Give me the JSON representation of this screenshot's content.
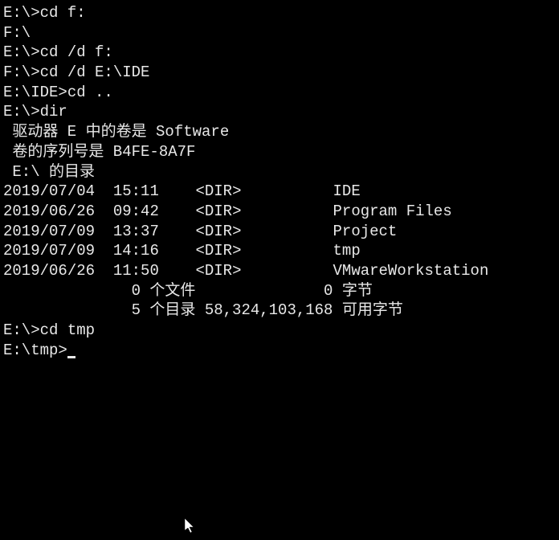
{
  "lines": [
    {
      "prompt": "E:\\>",
      "cmd": "cd f:"
    },
    {
      "text": "F:\\"
    },
    {
      "text": ""
    },
    {
      "prompt": "E:\\>",
      "cmd": "cd /d f:"
    },
    {
      "text": ""
    },
    {
      "prompt": "F:\\>",
      "cmd": "cd /d E:\\IDE"
    },
    {
      "text": ""
    },
    {
      "prompt": "E:\\IDE>",
      "cmd": "cd .."
    },
    {
      "text": ""
    },
    {
      "prompt": "E:\\>",
      "cmd": "dir"
    }
  ],
  "dir_output": {
    "volume_line": " 驱动器 E 中的卷是 Software",
    "serial_line": " 卷的序列号是 B4FE-8A7F",
    "blank1": "",
    "path_line": " E:\\ 的目录",
    "blank2": "",
    "entries": [
      {
        "date": "2019/07/04",
        "time": "15:11",
        "type": "<DIR>",
        "name": "IDE"
      },
      {
        "date": "2019/06/26",
        "time": "09:42",
        "type": "<DIR>",
        "name": "Program Files"
      },
      {
        "date": "2019/07/09",
        "time": "13:37",
        "type": "<DIR>",
        "name": "Project"
      },
      {
        "date": "2019/07/09",
        "time": "14:16",
        "type": "<DIR>",
        "name": "tmp"
      },
      {
        "date": "2019/06/26",
        "time": "11:50",
        "type": "<DIR>",
        "name": "VMwareWorkstation"
      }
    ],
    "summary_files": "              0 个文件              0 字节",
    "summary_dirs": "              5 个目录 58,324,103,168 可用字节"
  },
  "after_lines": [
    {
      "text": ""
    },
    {
      "prompt": "E:\\>",
      "cmd": "cd tmp"
    },
    {
      "text": ""
    }
  ],
  "current_prompt": "E:\\tmp>",
  "current_input": ""
}
